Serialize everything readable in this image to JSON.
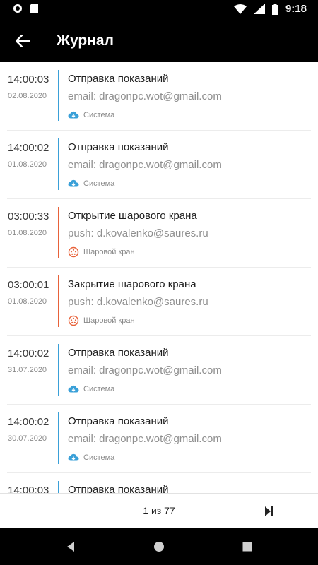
{
  "status_bar": {
    "time": "9:18"
  },
  "header": {
    "title": "Журнал"
  },
  "events": [
    {
      "time": "14:00:03",
      "date": "02.08.2020",
      "title": "Отправка показаний",
      "subtitle": "email: dragonpc.wot@gmail.com",
      "source": "Система",
      "kind": "system",
      "accent": "#3aa0d8"
    },
    {
      "time": "14:00:02",
      "date": "01.08.2020",
      "title": "Отправка показаний",
      "subtitle": "email: dragonpc.wot@gmail.com",
      "source": "Система",
      "kind": "system",
      "accent": "#3aa0d8"
    },
    {
      "time": "03:00:33",
      "date": "01.08.2020",
      "title": "Открытие шарового крана",
      "subtitle": "push: d.kovalenko@saures.ru",
      "source": "Шаровой кран",
      "kind": "valve",
      "accent": "#e8623a"
    },
    {
      "time": "03:00:01",
      "date": "01.08.2020",
      "title": "Закрытие шарового крана",
      "subtitle": "push: d.kovalenko@saures.ru",
      "source": "Шаровой кран",
      "kind": "valve",
      "accent": "#e8623a"
    },
    {
      "time": "14:00:02",
      "date": "31.07.2020",
      "title": "Отправка показаний",
      "subtitle": "email: dragonpc.wot@gmail.com",
      "source": "Система",
      "kind": "system",
      "accent": "#3aa0d8"
    },
    {
      "time": "14:00:02",
      "date": "30.07.2020",
      "title": "Отправка показаний",
      "subtitle": "email: dragonpc.wot@gmail.com",
      "source": "Система",
      "kind": "system",
      "accent": "#3aa0d8"
    },
    {
      "time": "14:00:03",
      "date": "",
      "title": "Отправка показаний",
      "subtitle": "",
      "source": "",
      "kind": "system",
      "accent": "#3aa0d8"
    }
  ],
  "icons": {
    "system": "cloud-download-icon",
    "valve": "ball-valve-icon",
    "back": "arrow-back-icon",
    "last_page": "last-page-icon"
  },
  "pager": {
    "label": "1 из 77"
  }
}
